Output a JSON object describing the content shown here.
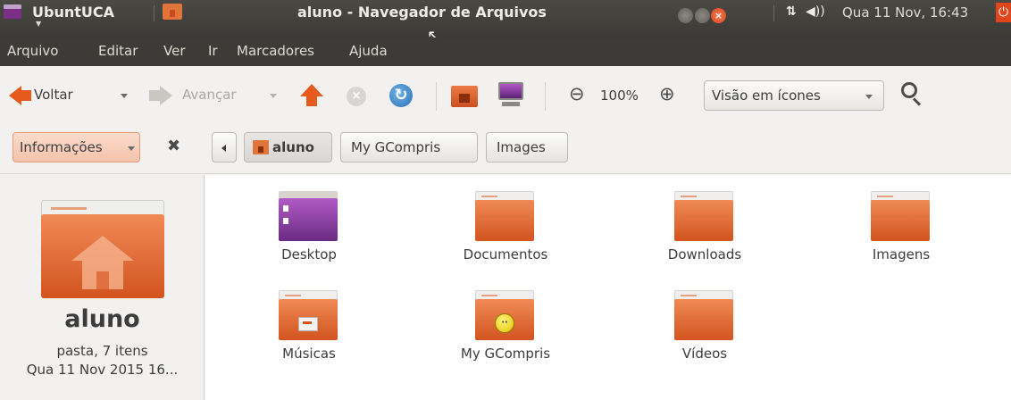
{
  "topbar": {
    "app_name": "UbuntUCA",
    "window_title": "aluno - Navegador de Arquivos",
    "clock": "Qua 11 Nov, 16:43"
  },
  "menu": [
    "Arquivo",
    "Editar",
    "Ver",
    "Ir",
    "Marcadores",
    "Ajuda"
  ],
  "toolbar": {
    "back_label": "Voltar",
    "forward_label": "Avançar",
    "zoom_level": "100%",
    "view_mode": "Visão em ícones"
  },
  "location": {
    "info_label": "Informações",
    "crumbs": [
      "aluno",
      "My GCompris",
      "Images"
    ]
  },
  "sidepane": {
    "name": "aluno",
    "meta": "pasta, 7 itens",
    "date": "Qua 11 Nov 2015 16..."
  },
  "files": [
    {
      "name": "Desktop"
    },
    {
      "name": "Documentos"
    },
    {
      "name": "Downloads"
    },
    {
      "name": "Imagens"
    },
    {
      "name": "Músicas"
    },
    {
      "name": "My GCompris"
    },
    {
      "name": "Vídeos"
    }
  ],
  "colors": {
    "accent": "#e65a1e",
    "panel_dark": "#3c3b37",
    "folder_orange": "#e0743a"
  }
}
